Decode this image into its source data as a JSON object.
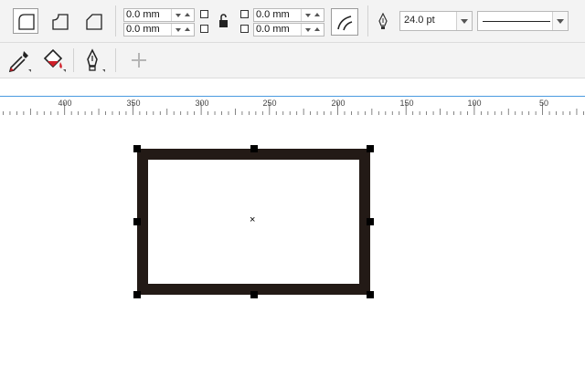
{
  "toolbar": {
    "corner_buttons": [
      {
        "name": "round-corner",
        "active": true
      },
      {
        "name": "scalloped-corner",
        "active": false
      },
      {
        "name": "chamfered-corner",
        "active": false
      }
    ],
    "corner_radius": {
      "top_left": "0.0 mm",
      "bottom_left": "0.0 mm",
      "top_right": "0.0 mm",
      "bottom_right": "0.0 mm"
    },
    "outline_width": "24.0 pt",
    "outline_style": "solid-line"
  },
  "tools": [
    {
      "name": "eyedropper-icon"
    },
    {
      "name": "fill-bucket-icon"
    },
    {
      "name": "pen-icon"
    },
    {
      "name": "add-icon"
    }
  ],
  "ruler": {
    "labels": [
      "400",
      "350",
      "300",
      "250",
      "200",
      "150",
      "100",
      "50"
    ]
  },
  "colors": {
    "shape_outline": "#231a16",
    "ruler_accent": "#4a9be0",
    "fill_icon_red": "#d0202a"
  }
}
